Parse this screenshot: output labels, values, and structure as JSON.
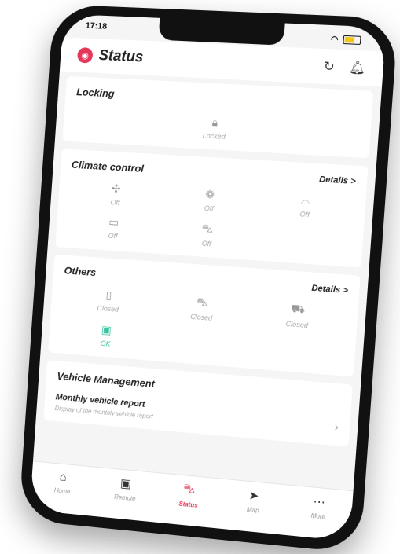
{
  "status_bar": {
    "time": "17:18",
    "wifi_icon": "wifi-icon",
    "battery_icon": "battery-icon"
  },
  "header": {
    "title": "Status",
    "logo_icon": "brand-logo-icon",
    "refresh_icon": "refresh-icon",
    "bell_icon": "bell-icon"
  },
  "locking": {
    "title": "Locking",
    "item": {
      "icon": "lock-icon",
      "label": "Locked"
    }
  },
  "climate": {
    "title": "Climate control",
    "details": "Details >",
    "items": [
      {
        "icon": "fan-icon",
        "label": "Off"
      },
      {
        "icon": "seat-heat-icon",
        "label": "Off"
      },
      {
        "icon": "windshield-icon",
        "label": "Off"
      },
      {
        "icon": "rear-window-icon",
        "label": "Off"
      },
      {
        "icon": "car-climate-icon",
        "label": "Off"
      }
    ]
  },
  "others": {
    "title": "Others",
    "details": "Details >",
    "items": [
      {
        "icon": "door-icon",
        "label": "Closed",
        "state": "normal"
      },
      {
        "icon": "car-side-icon",
        "label": "Closed",
        "state": "normal"
      },
      {
        "icon": "trunk-icon",
        "label": "Closed",
        "state": "normal"
      },
      {
        "icon": "battery-icon",
        "label": "OK",
        "state": "ok"
      }
    ]
  },
  "vehicle_management": {
    "title": "Vehicle Management",
    "report_title": "Monthly vehicle report",
    "report_sub": "Display of the monthly vehicle report"
  },
  "tabs": [
    {
      "label": "Home",
      "icon": "home-icon"
    },
    {
      "label": "Remote",
      "icon": "remote-icon"
    },
    {
      "label": "Status",
      "icon": "car-status-icon",
      "active": true
    },
    {
      "label": "Map",
      "icon": "navigation-icon"
    },
    {
      "label": "More",
      "icon": "more-icon"
    }
  ],
  "colors": {
    "accent": "#e5375a",
    "ok": "#3ec3a0"
  }
}
